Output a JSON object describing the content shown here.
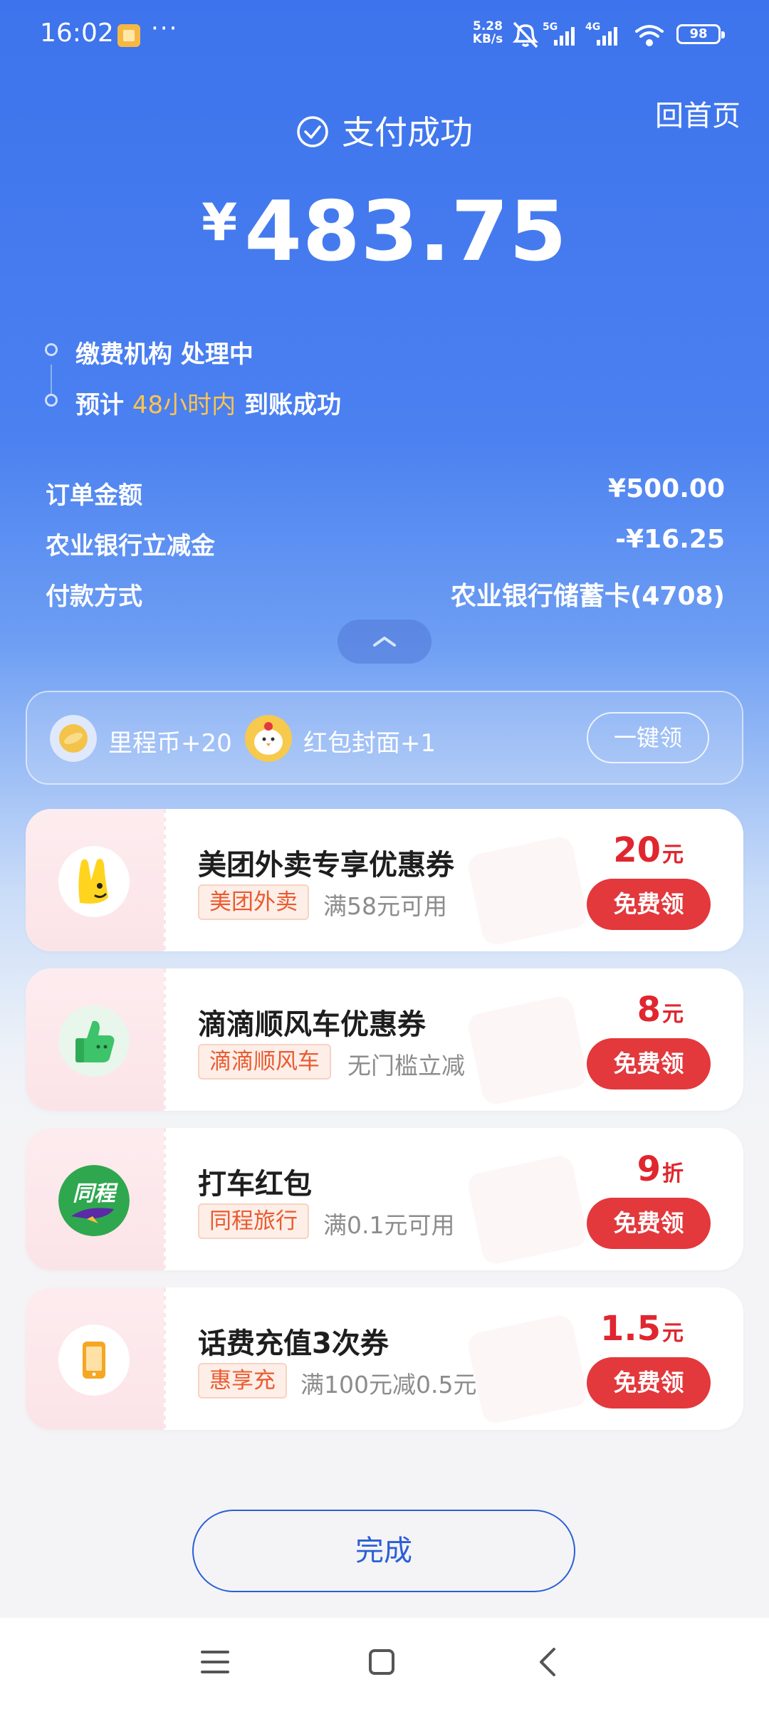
{
  "status_bar": {
    "time": "16:02",
    "more": "···",
    "net_speed_value": "5.28",
    "net_speed_unit": "KB/s",
    "signal_1": "5G",
    "signal_2": "4G",
    "battery": "98",
    "icons": [
      "app-notification-icon",
      "mute-bell-icon",
      "signal-5g-icon",
      "signal-4g-icon",
      "wifi-icon",
      "battery-icon"
    ]
  },
  "header": {
    "home_link": "回首页",
    "success_text": "支付成功",
    "currency_symbol": "¥",
    "amount": "483.75"
  },
  "timeline": {
    "step1": "缴费机构 处理中",
    "step2_prefix": "预计 ",
    "step2_highlight": "48小时内",
    "step2_suffix": " 到账成功",
    "highlight_color": "#ffc44d"
  },
  "details": [
    {
      "label": "订单金额",
      "value": "¥500.00"
    },
    {
      "label": "农业银行立减金",
      "value": "-¥16.25"
    },
    {
      "label": "付款方式",
      "value": "农业银行储蓄卡(4708)"
    }
  ],
  "rewards": {
    "item1": "里程币+20",
    "item2": "红包封面+1",
    "claim_all": "一键领"
  },
  "coupons": [
    {
      "title": "美团外卖专享优惠券",
      "tag": "美团外卖",
      "condition": "满58元可用",
      "value": "20",
      "unit": "元",
      "button": "免费领",
      "icon": "meituan-kangaroo-icon"
    },
    {
      "title": "滴滴顺风车优惠券",
      "tag": "滴滴顺风车",
      "condition": "无门槛立减",
      "value": "8",
      "unit": "元",
      "button": "免费领",
      "icon": "thumbs-up-icon"
    },
    {
      "title": "打车红包",
      "tag": "同程旅行",
      "condition": "满0.1元可用",
      "value": "9",
      "unit": "折",
      "button": "免费领",
      "icon": "tongcheng-logo-icon",
      "logo_text": "同程"
    },
    {
      "title": "话费充值3次券",
      "tag": "惠享充",
      "condition": "满100元减0.5元",
      "value": "1.5",
      "unit": "元",
      "button": "免费领",
      "icon": "phone-icon"
    }
  ],
  "done_button": "完成",
  "colors": {
    "primary_blue": "#3d73ec",
    "accent_red": "#e3383c",
    "tag_orange": "#ea5b2f"
  }
}
